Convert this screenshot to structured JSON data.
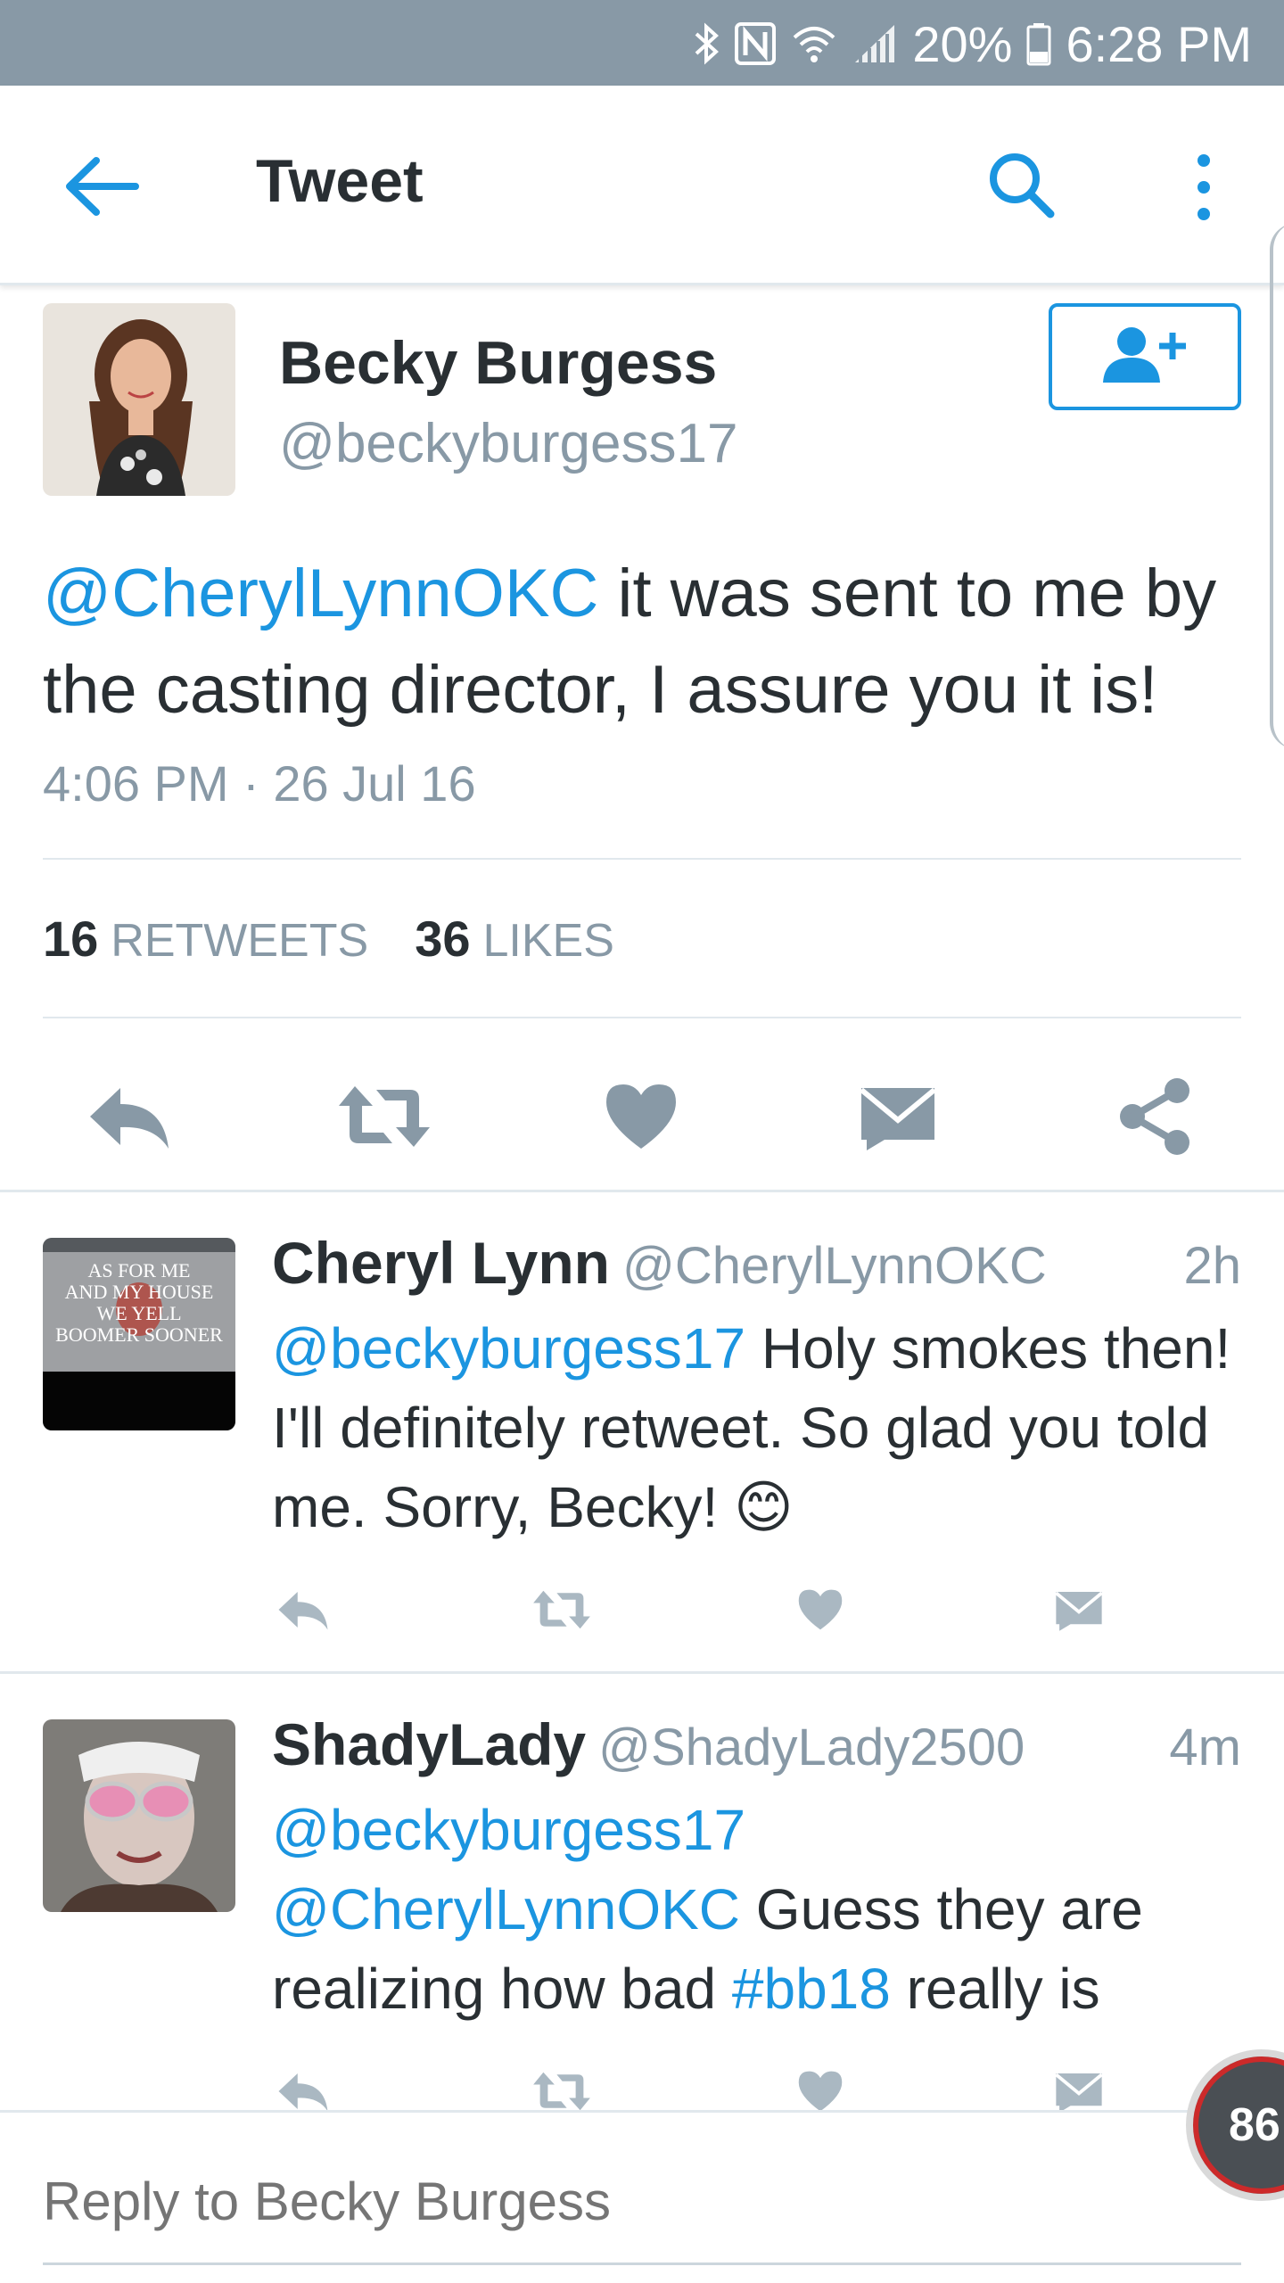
{
  "status_bar": {
    "battery": "20%",
    "time": "6:28 PM",
    "icons": [
      "bluetooth-icon",
      "nfc-icon",
      "wifi-icon",
      "signal-icon",
      "battery-icon"
    ]
  },
  "app_bar": {
    "title": "Tweet",
    "icons": [
      "back-arrow-icon",
      "search-icon",
      "more-vertical-icon"
    ]
  },
  "tweet": {
    "author_name": "Becky Burgess",
    "author_handle": "@beckyburgess17",
    "mention": "@CherylLynnOKC",
    "text": " it was sent to me by the casting director, I assure you it is!",
    "timestamp": "4:06 PM · 26 Jul 16",
    "retweets_count": "16",
    "retweets_label": "RETWEETS",
    "likes_count": "36",
    "likes_label": "LIKES",
    "follow_icon": "add-user-icon",
    "actions": [
      "reply-icon",
      "retweet-icon",
      "like-icon",
      "direct-message-icon",
      "share-icon"
    ]
  },
  "replies": [
    {
      "name": "Cheryl Lynn",
      "handle": "@CherylLynnOKC",
      "time": "2h",
      "mention": "@beckyburgess17",
      "text": " Holy smokes then! I'll definitely retweet. So glad you told me. Sorry, Becky!",
      "emoji": "😊",
      "avatar_lines": [
        "AS FOR ME",
        "AND MY HOUSE",
        "WE YELL",
        "BOOMER SOONER"
      ]
    },
    {
      "name": "ShadyLady",
      "handle": "@ShadyLady2500",
      "time": "4m",
      "mention1": "@beckyburgess17",
      "mention2": "@CherylLynnOKC",
      "text_mid": " Guess they are realizing how bad ",
      "hashtag": "#bb18",
      "text_end": " really is"
    }
  ],
  "composer": {
    "placeholder": "Reply to Becky Burgess"
  },
  "overlay": {
    "badge_value": "86"
  },
  "colors": {
    "accent": "#1b95e0",
    "status_bar": "#8899a6",
    "icon_gray": "#8899a6",
    "text": "#292f33"
  }
}
